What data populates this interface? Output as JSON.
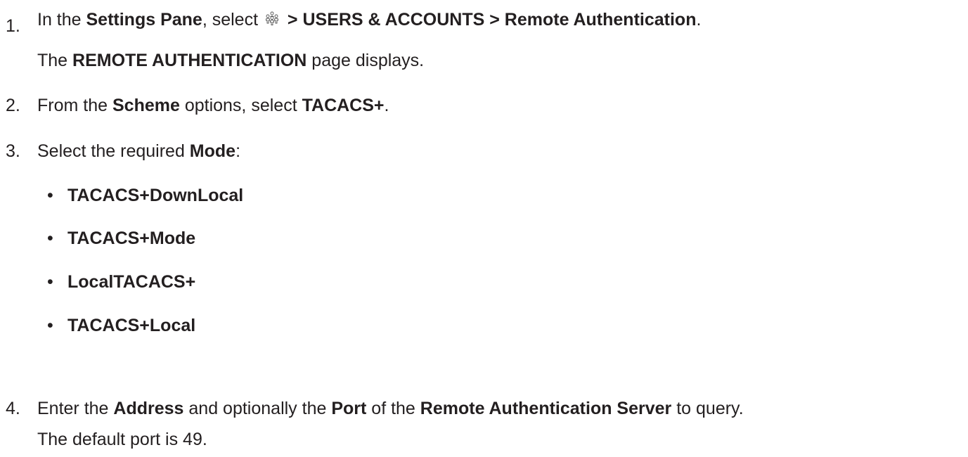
{
  "step1": {
    "number": "1.",
    "prefix": "In the ",
    "pane": "Settings Pane",
    "mid": ", select ",
    "icon": "users-icon",
    "path": " > USERS & ACCOUNTS > Remote Authentication",
    "suffix": ".",
    "result_label": "REMOTE AUTHENTICATION",
    "result_prefix": "The ",
    "result_suffix": " page displays."
  },
  "step2": {
    "number": "2.",
    "prefix": "From the ",
    "scheme": "Scheme",
    "mid": " options, select ",
    "value": "TACACS+",
    "suffix": "."
  },
  "step3": {
    "number": "3.",
    "prefix": "Select the required ",
    "mode": "Mode",
    "suffix": ":",
    "bullet_char": "•",
    "options": [
      "TACACS+DownLocal",
      "TACACS+Mode",
      "LocalTACACS+",
      "TACACS+Local"
    ]
  },
  "step4": {
    "number": "4.",
    "prefix": "Enter the ",
    "address": "Address",
    "mid1": " and optionally the ",
    "port": "Port",
    "mid2": " of the ",
    "server": "Remote Authentication Server",
    "suffix": " to query.",
    "note": "The default port is 49."
  }
}
